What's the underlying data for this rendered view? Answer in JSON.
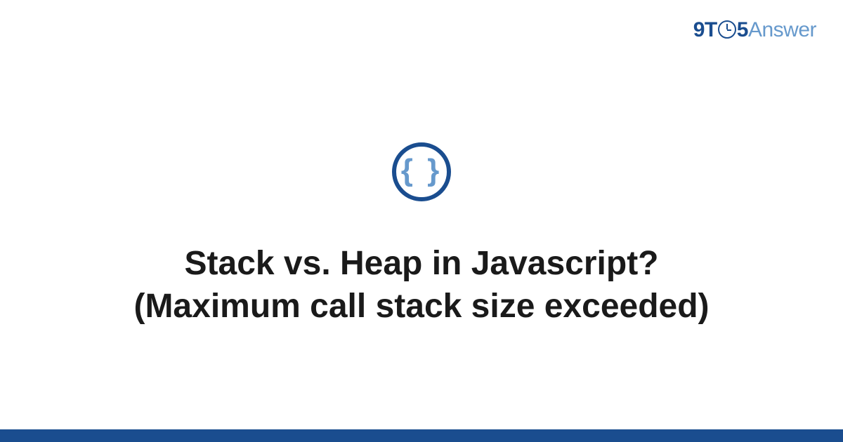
{
  "logo": {
    "part1": "9T",
    "part2": "5",
    "part3": "Answer"
  },
  "icon": {
    "name": "code-braces-icon",
    "glyph": "{ }"
  },
  "title": "Stack vs. Heap in Javascript? (Maximum call stack size exceeded)",
  "colors": {
    "primary": "#1a4d8f",
    "accent": "#6699cc"
  }
}
